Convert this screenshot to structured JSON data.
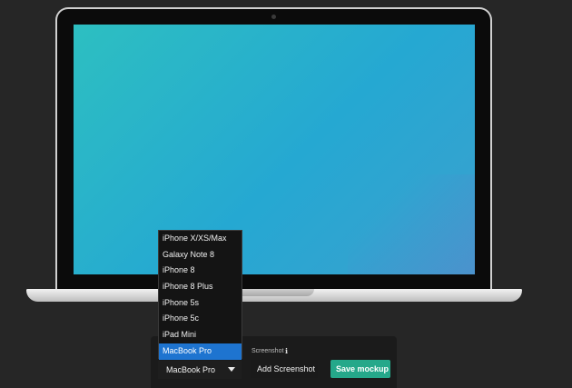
{
  "device": {
    "name": "MacBook Pro"
  },
  "toolbar": {
    "selected_device": "MacBook Pro",
    "screenshot_label": "Screenshot",
    "info_icon": "ℹ",
    "add_screenshot_label": "Add Screenshot",
    "save_label": "Save mockup",
    "save_color": "#25a88a"
  },
  "dropdown": {
    "options": [
      "iPhone X/XS/Max",
      "Galaxy Note 8",
      "iPhone 8",
      "iPhone 8 Plus",
      "iPhone 5s",
      "iPhone 5c",
      "iPad Mini",
      "MacBook Pro"
    ],
    "selected_index": 7,
    "highlight_color": "#1e74d0"
  },
  "screen": {
    "gradient_from": "#2dbfc1",
    "gradient_to": "#3ba0cf"
  }
}
